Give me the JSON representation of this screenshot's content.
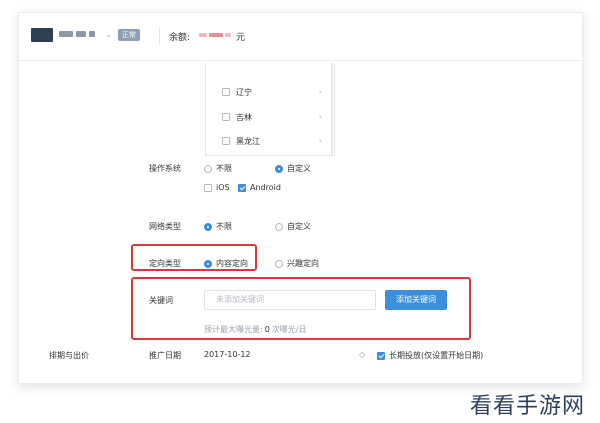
{
  "header": {
    "status_badge": "正常",
    "balance_label": "余额:",
    "balance_unit": "元"
  },
  "regions": [
    {
      "label": "辽宁",
      "arrow": "›"
    },
    {
      "label": "吉林",
      "arrow": "›"
    },
    {
      "label": "黑龙江",
      "arrow": "›"
    }
  ],
  "os": {
    "label": "操作系统",
    "options": [
      "不限",
      "自定义"
    ],
    "selected": "自定义",
    "platforms": [
      {
        "label": "iOS",
        "checked": false
      },
      {
        "label": "Android",
        "checked": true
      }
    ]
  },
  "network": {
    "label": "网络类型",
    "options": [
      "不限",
      "自定义"
    ],
    "selected": "不限"
  },
  "targeting": {
    "label": "定向类型",
    "options": [
      "内容定向",
      "兴趣定向"
    ],
    "selected": "内容定向"
  },
  "keywords": {
    "label": "关键词",
    "placeholder": "未添加关键词",
    "button": "添加关键词",
    "expo_prefix": "预计最大曝光量:",
    "expo_value": "0",
    "expo_suffix": "次曝光/日"
  },
  "schedule": {
    "section_label": "排期与出价",
    "date_label": "推广日期",
    "date_value": "2017-10-12",
    "stepper_icon": "◇",
    "long_term_label": "长期投放(仅设置开始日期)",
    "long_term_checked": true
  },
  "watermark": "看看手游网",
  "colors": {
    "accent": "#3b8fdb",
    "highlight_border": "#d9383a"
  }
}
